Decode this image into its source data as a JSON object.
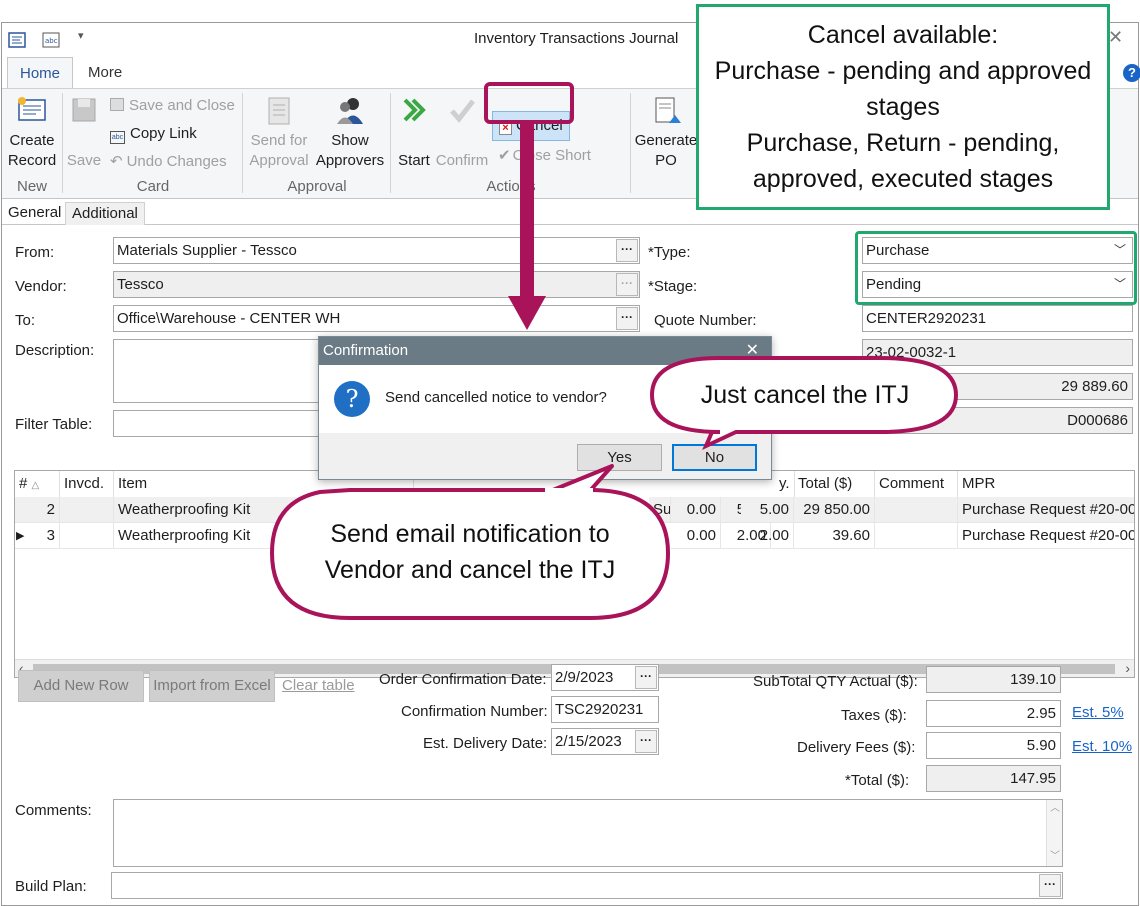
{
  "window": {
    "title": "Inventory Transactions Journal"
  },
  "ribbon_tabs": [
    "Home",
    "More"
  ],
  "ribbon": {
    "create_record": "Create Record",
    "save": "Save",
    "save_and_close": "Save and Close",
    "copy_link": "Copy Link",
    "undo_changes": "Undo Changes",
    "send_for_approval": "Send for Approval",
    "show_approvers": "Show Approvers",
    "start": "Start",
    "confirm": "Confirm",
    "cancel": "Cancel",
    "close_short": "Close Short",
    "generate_po": "Generate PO",
    "groups": {
      "new": "New",
      "card": "Card",
      "approval": "Approval",
      "actions": "Actions"
    }
  },
  "subtabs": [
    "General",
    "Additional"
  ],
  "form": {
    "from_label": "From:",
    "from_value": "Materials Supplier - Tessco",
    "vendor_label": "Vendor:",
    "vendor_value": "Tessco",
    "to_label": "To:",
    "to_value": "Office\\Warehouse - CENTER WH",
    "description_label": "Description:",
    "filter_label": "Filter Table:",
    "type_label": "*Type:",
    "type_value": "Purchase",
    "stage_label": "*Stage:",
    "stage_value": "Pending",
    "quote_label": "Quote Number:",
    "quote_value": "CENTER2920231",
    "field4_value": "23-02-0032-1",
    "field5_value": "29 889.60",
    "field6_value": "D000686"
  },
  "grid": {
    "headers": [
      "#",
      "Invcd.",
      "Item",
      "Total ($)",
      "Comment",
      "MPR"
    ],
    "partial_header_qty": "y.",
    "rows": [
      {
        "num": "2",
        "item": "Weatherproofing Kit",
        "c1": "0.00",
        "c2": "5.00",
        "c3": "5.00",
        "total": "29 850.00",
        "comment": "",
        "mpr": "Purchase Request #20-001"
      },
      {
        "num": "3",
        "item": "Weatherproofing Kit",
        "c1": "0.00",
        "c2": "2.00",
        "c3": "2.00",
        "total": "39.60",
        "comment": "",
        "mpr": "Purchase Request #20-001"
      }
    ],
    "row2_partial": "Sup"
  },
  "bottom": {
    "add_new_row": "Add New Row",
    "import_excel": "Import from Excel",
    "clear_table": "Clear table",
    "order_conf_date_label": "Order Confirmation Date:",
    "order_conf_date": "2/9/2023",
    "conf_number_label": "Confirmation Number:",
    "conf_number": "TSC2920231",
    "est_delivery_label": "Est. Delivery Date:",
    "est_delivery": "2/15/2023",
    "subtotal_label": "SubTotal QTY Actual ($):",
    "subtotal": "139.10",
    "taxes_label": "Taxes ($):",
    "taxes": "2.95",
    "est5": "Est. 5%",
    "delivery_label": "Delivery Fees ($):",
    "delivery": "5.90",
    "est10": "Est. 10%",
    "total_label": "*Total ($):",
    "total": "147.95",
    "comments_label": "Comments:",
    "build_plan_label": "Build Plan:"
  },
  "dialog": {
    "title": "Confirmation",
    "message": "Send cancelled notice to vendor?",
    "yes": "Yes",
    "no": "No"
  },
  "annotations": {
    "cancel_available": [
      "Cancel available:",
      "Purchase - pending and approved stages",
      "Purchase, Return - pending, approved, executed stages"
    ],
    "just_cancel": "Just cancel the ITJ",
    "send_email": [
      "Send email notification to",
      "Vendor and cancel the ITJ"
    ]
  },
  "colors": {
    "annotation_magenta": "#a8135a",
    "annotation_green": "#20a86e",
    "accent_blue": "#2b579a"
  }
}
